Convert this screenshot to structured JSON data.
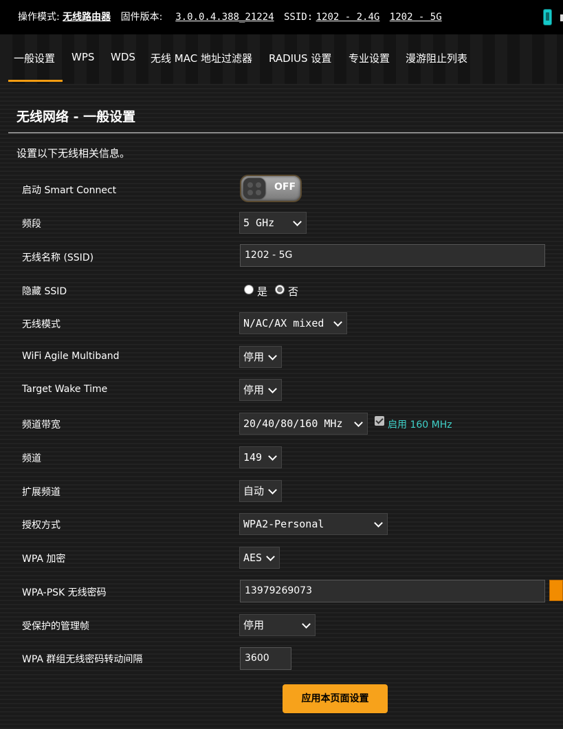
{
  "status_bar": {
    "mode_label": "操作模式:",
    "mode_value": "无线路由器",
    "firmware_label": "固件版本:",
    "firmware_value": "3.0.0.4.388_21224",
    "ssid_label": "SSID:",
    "ssid_24": "1202 - 2.4G",
    "ssid_5": "1202 - 5G",
    "usb_icon": "usb-icon"
  },
  "tabs": [
    {
      "label": "一般设置"
    },
    {
      "label": "WPS"
    },
    {
      "label": "WDS"
    },
    {
      "label": "无线 MAC 地址过滤器"
    },
    {
      "label": "RADIUS 设置"
    },
    {
      "label": "专业设置"
    },
    {
      "label": "漫游阻止列表"
    }
  ],
  "panel": {
    "title": "无线网络 - 一般设置",
    "description": "设置以下无线相关信息。"
  },
  "form": {
    "smart_connect": {
      "label": "启动 Smart Connect",
      "state": "OFF"
    },
    "band": {
      "label": "频段",
      "value": "5 GHz"
    },
    "ssid": {
      "label": "无线名称 (SSID)",
      "value": "1202 - 5G"
    },
    "hide_ssid": {
      "label": "隐藏 SSID",
      "yes": "是",
      "no": "否",
      "selected": "否"
    },
    "wireless_mode": {
      "label": "无线模式",
      "value": "N/AC/AX mixed"
    },
    "agile_multiband": {
      "label": "WiFi Agile Multiband",
      "value": "停用"
    },
    "target_wake_time": {
      "label": "Target Wake Time",
      "value": "停用"
    },
    "bandwidth": {
      "label": "频道带宽",
      "value": "20/40/80/160 MHz",
      "enable_160_label": "启用 160 MHz",
      "enable_160_checked": true
    },
    "channel": {
      "label": "频道",
      "value": "149"
    },
    "ext_channel": {
      "label": "扩展频道",
      "value": "自动"
    },
    "auth_method": {
      "label": "授权方式",
      "value": "WPA2-Personal"
    },
    "wpa_encryption": {
      "label": "WPA 加密",
      "value": "AES"
    },
    "wpa_psk": {
      "label": "WPA-PSK 无线密码",
      "value": "13979269073"
    },
    "pmf": {
      "label": "受保护的管理帧",
      "value": "停用"
    },
    "group_key_interval": {
      "label": "WPA 群组无线密码转动间隔",
      "value": "3600"
    }
  },
  "apply_button": {
    "label": "应用本页面设置"
  },
  "colors": {
    "accent": "#f39c12",
    "teal": "#3fd0c8",
    "apply": "#f7a21b"
  }
}
